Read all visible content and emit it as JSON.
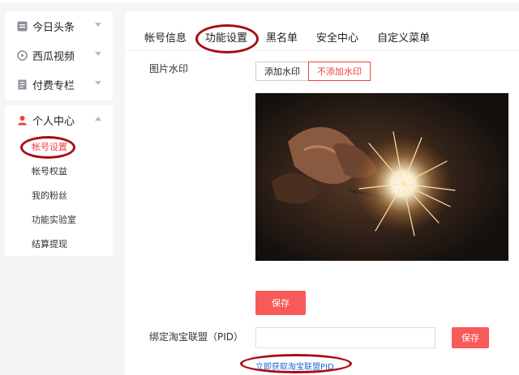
{
  "sidebar": {
    "groups": [
      {
        "label": "今日头条",
        "icon": "toutiao-icon"
      },
      {
        "label": "西瓜视频",
        "icon": "xigua-icon"
      },
      {
        "label": "付费专栏",
        "icon": "column-icon"
      }
    ],
    "personal": {
      "label": "个人中心",
      "icon": "user-icon",
      "items": [
        "帐号设置",
        "帐号权益",
        "我的粉丝",
        "功能实验室",
        "结算提现"
      ],
      "active_index": 0
    }
  },
  "tabs": [
    "帐号信息",
    "功能设置",
    "黑名单",
    "安全中心",
    "自定义菜单"
  ],
  "active_tab": 1,
  "watermark": {
    "label": "图片水印",
    "options": [
      "添加水印",
      "不添加水印"
    ],
    "selected": "不添加水印"
  },
  "save_label": "保存",
  "pid": {
    "label": "绑定淘宝联盟（PID）",
    "value": "",
    "save_label": "保存",
    "link": "立即获取淘宝联盟PID"
  },
  "colors": {
    "accent": "#f04142",
    "button": "#f85959",
    "link": "#1e6bd6",
    "annotation": "#a50e14"
  }
}
